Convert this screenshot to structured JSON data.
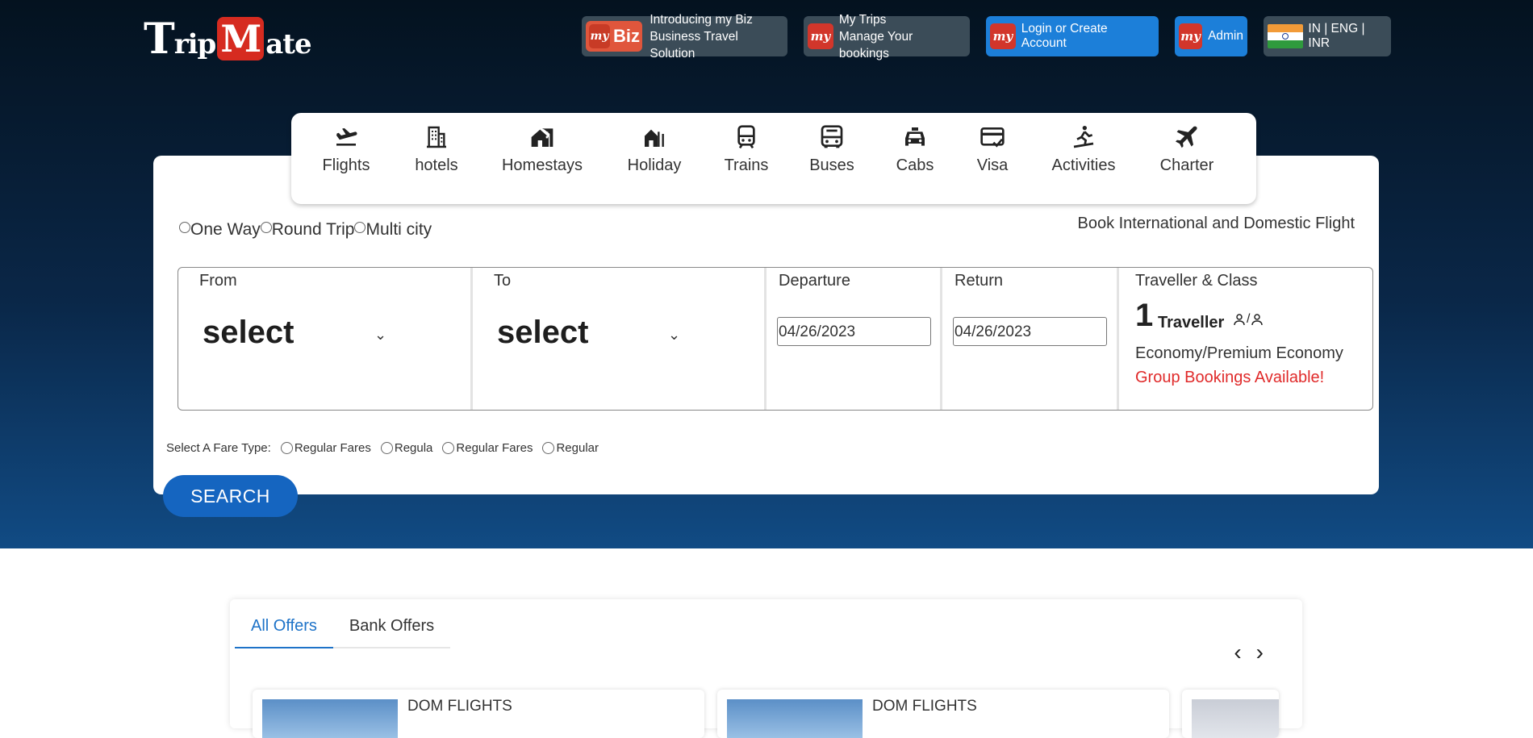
{
  "brand": {
    "logo_t": "T",
    "logo_rip": "rip",
    "logo_m": "M",
    "logo_ate": "ate"
  },
  "header": {
    "biz_logo_text": "Biz",
    "biz_line1": "Introducing my Biz",
    "biz_line2": "Business Travel Solution",
    "trips_line1": "My Trips",
    "trips_line2": "Manage Your bookings",
    "login_label": "Login or Create Account",
    "admin_label": "Admin",
    "locale_label": "IN | ENG | INR",
    "my_logo_text": "my"
  },
  "nav": [
    {
      "label": "Flights",
      "icon": "flight-land-icon"
    },
    {
      "label": "hotels",
      "icon": "hotel-building-icon"
    },
    {
      "label": "Homestays",
      "icon": "homestay-icon"
    },
    {
      "label": "Holiday",
      "icon": "holiday-icon"
    },
    {
      "label": "Trains",
      "icon": "train-icon"
    },
    {
      "label": "Buses",
      "icon": "bus-icon"
    },
    {
      "label": "Cabs",
      "icon": "cab-icon"
    },
    {
      "label": "Visa",
      "icon": "visa-icon"
    },
    {
      "label": "Activities",
      "icon": "activities-icon"
    },
    {
      "label": "Charter",
      "icon": "charter-plane-icon"
    }
  ],
  "trip_types": [
    "One Way",
    "Round Trip",
    "Multi city"
  ],
  "book_title": "Book International and Domestic Flight",
  "fields": {
    "from_label": "From",
    "from_value": "select",
    "to_label": "To",
    "to_value": "select",
    "departure_label": "Departure",
    "departure_value": "04/26/2023",
    "return_label": "Return",
    "return_value": "04/26/2023",
    "traveller_label": "Traveller & Class",
    "traveller_count": "1",
    "traveller_word": "Traveller",
    "traveller_sep": "/",
    "class_value": "Economy/Premium Economy",
    "group_note": "Group Bookings Available!"
  },
  "fare": {
    "label": "Select A Fare Type:",
    "options": [
      "Regular Fares",
      "Regula",
      "Regular Fares",
      "Regular"
    ]
  },
  "search_label": "SEARCH",
  "offers": {
    "tabs": [
      "All Offers",
      "Bank Offers"
    ],
    "card_title": "DOM FLIGHTS"
  },
  "colors": {
    "accent": "#1565c0",
    "brand_red": "#d62b20",
    "alert": "#e02a2a",
    "hero_top": "#04121f",
    "hero_bottom": "#114b84"
  }
}
